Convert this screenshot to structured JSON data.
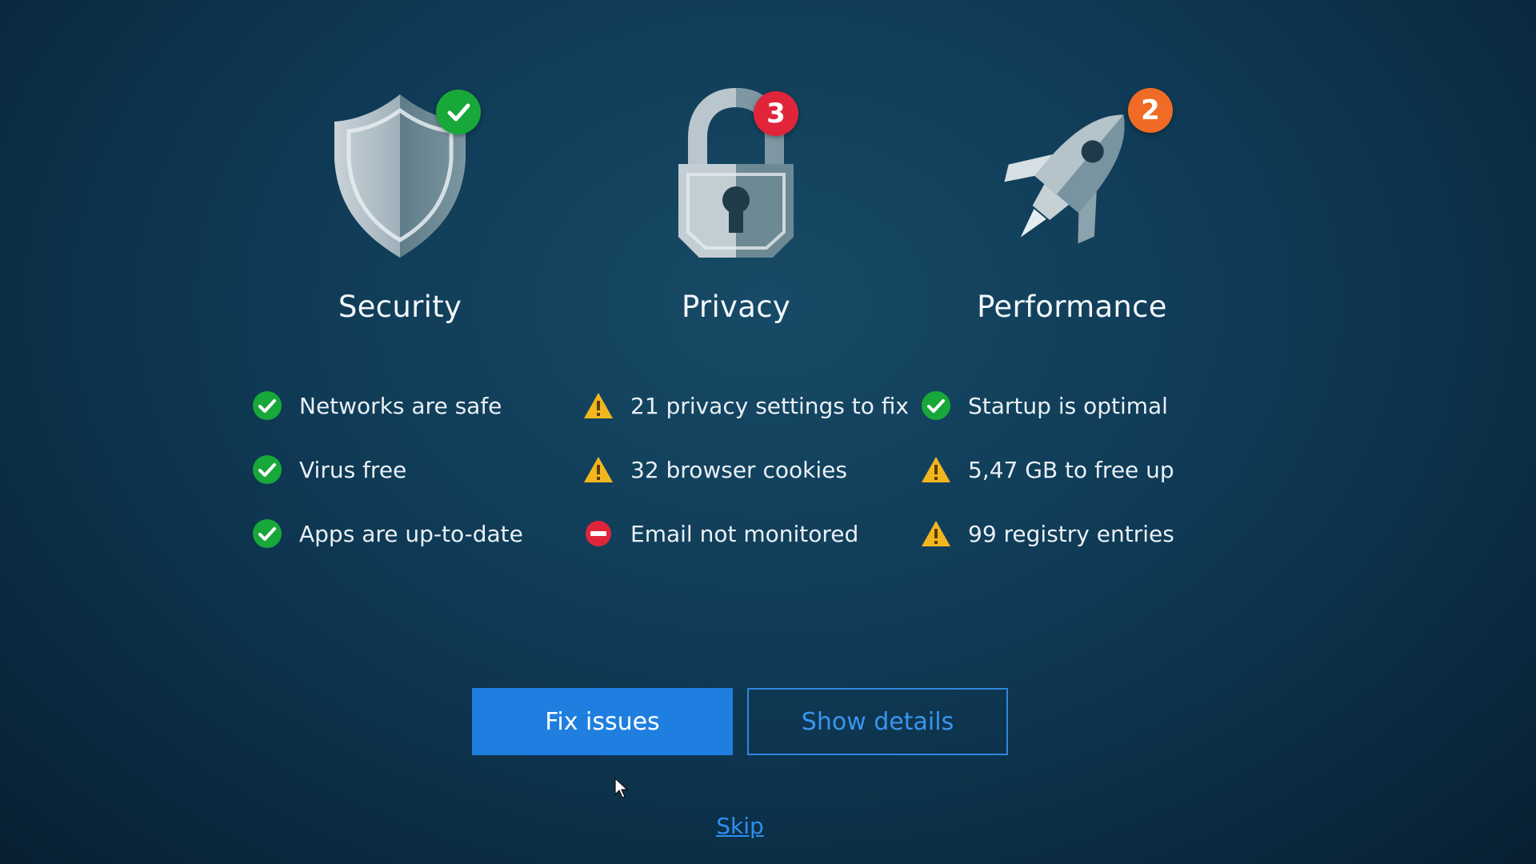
{
  "columns": {
    "security": {
      "title": "Security",
      "icon": "shield-icon",
      "badge": {
        "icon": "checkmark-icon",
        "color": "#18a83a"
      },
      "items": [
        {
          "status": "ok",
          "icon": "check-circle-icon",
          "label": "Networks are safe"
        },
        {
          "status": "ok",
          "icon": "check-circle-icon",
          "label": "Virus free"
        },
        {
          "status": "ok",
          "icon": "check-circle-icon",
          "label": "Apps are up-to-date"
        }
      ]
    },
    "privacy": {
      "title": "Privacy",
      "icon": "padlock-icon",
      "badge": {
        "count": "3",
        "color": "#e0253a"
      },
      "items": [
        {
          "status": "warning",
          "icon": "warning-triangle-icon",
          "label": "21 privacy settings to fix"
        },
        {
          "status": "warning",
          "icon": "warning-triangle-icon",
          "label": "32 browser cookies"
        },
        {
          "status": "error",
          "icon": "blocked-circle-icon",
          "label": "Email not monitored"
        }
      ]
    },
    "performance": {
      "title": "Performance",
      "icon": "rocket-icon",
      "badge": {
        "count": "2",
        "color": "#f06b25"
      },
      "items": [
        {
          "status": "ok",
          "icon": "check-circle-icon",
          "label": "Startup is optimal"
        },
        {
          "status": "warning",
          "icon": "warning-triangle-icon",
          "label": "5,47 GB to free up"
        },
        {
          "status": "warning",
          "icon": "warning-triangle-icon",
          "label": "99 registry entries"
        }
      ]
    }
  },
  "actions": {
    "fix_label": "Fix issues",
    "details_label": "Show details",
    "skip_label": "Skip"
  },
  "colors": {
    "ok": "#18a83a",
    "warning": "#f2b61f",
    "error": "#e0253a",
    "accent": "#1f7fe0"
  }
}
